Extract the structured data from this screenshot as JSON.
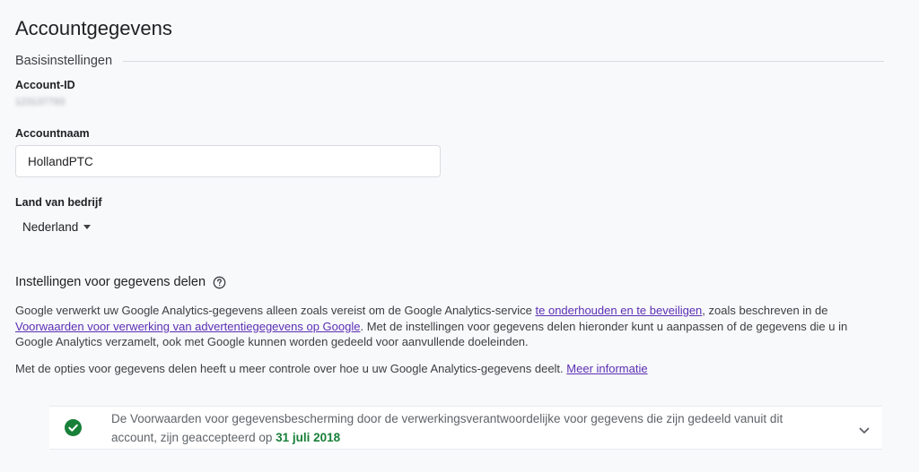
{
  "page": {
    "title": "Accountgegevens"
  },
  "basic_settings": {
    "section_title": "Basisinstellingen",
    "account_id_label": "Account-ID",
    "account_id_value": "123137793",
    "account_name_label": "Accountnaam",
    "account_name_value": "HollandPTC",
    "country_label": "Land van bedrijf",
    "country_value": "Nederland"
  },
  "data_sharing": {
    "heading": "Instellingen voor gegevens delen",
    "help_icon": "help-circle-icon",
    "para1_part1": "Google verwerkt uw Google Analytics-gegevens alleen zoals vereist om de Google Analytics-service ",
    "para1_link1": "te onderhouden en te beveiligen",
    "para1_part2": ", zoals beschreven in de ",
    "para1_link2": "Voorwaarden voor verwerking van advertentiegegevens op Google",
    "para1_part3": ". Met de instellingen voor gegevens delen hieronder kunt u aanpassen of de gegevens die u in Google Analytics verzamelt, ook met Google kunnen worden gedeeld voor aanvullende doeleinden.",
    "para2_text": "Met de opties voor gegevens delen heeft u meer controle over hoe u uw Google Analytics-gegevens deelt. ",
    "para2_link": "Meer informatie"
  },
  "terms_card": {
    "icon": "check-circle-icon",
    "text": "De Voorwaarden voor gegevensbescherming door de verwerkingsverantwoordelijke voor gegevens die zijn gedeeld vanuit dit account, zijn geaccepteerd op ",
    "date": "31 juli 2018",
    "expand_icon": "chevron-down-icon"
  },
  "colors": {
    "link": "#5b2fb5",
    "success": "#188038",
    "border": "#dadce0"
  }
}
